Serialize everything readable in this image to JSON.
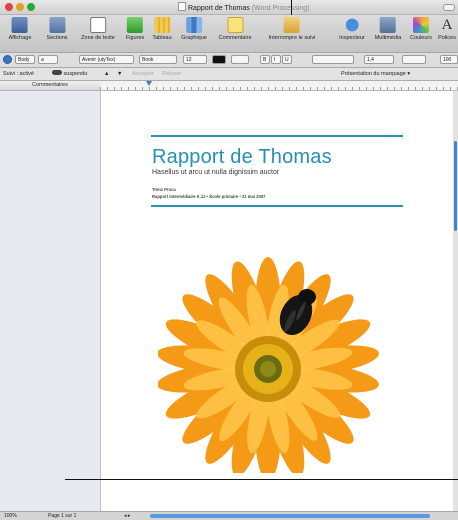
{
  "window": {
    "title": "Rapport de Thomas",
    "subtitle": "(Word Processing)"
  },
  "toolbar": {
    "items": [
      {
        "label": "Affichage",
        "icon": "view-icon"
      },
      {
        "label": "Sections",
        "icon": "sections-icon"
      },
      {
        "label": "Zone de texte",
        "icon": "text-box-icon"
      },
      {
        "label": "Figures",
        "icon": "shapes-icon"
      },
      {
        "label": "Tableau",
        "icon": "table-icon"
      },
      {
        "label": "Graphique",
        "icon": "chart-icon"
      },
      {
        "label": "Commentaire",
        "icon": "comment-icon"
      },
      {
        "label": "Interrompre le suivi",
        "icon": "track-changes-icon"
      },
      {
        "label": "Inspecteur",
        "icon": "inspector-icon"
      },
      {
        "label": "Multimédia",
        "icon": "media-icon"
      },
      {
        "label": "Couleurs",
        "icon": "colors-icon"
      },
      {
        "label": "Polices",
        "icon": "fonts-icon"
      }
    ],
    "font_glyph": "A"
  },
  "format_bar": {
    "style_a": "a",
    "paragraph_style": "Body",
    "font_family": "Avenir (utyTex)",
    "font_weight": "Book",
    "font_size": "12",
    "bold": "B",
    "italic": "I",
    "underline": "U",
    "line_spacing": "1,4",
    "zoom": "100"
  },
  "tracking": {
    "label": "Suivi : activé",
    "state": "suspendu",
    "accept": "Accepter",
    "reject": "Refuser",
    "markup_view": "Présentation du marquage"
  },
  "sidebar": {
    "header": "Commentaires"
  },
  "document": {
    "title": "Rapport de Thomas",
    "subtitle": "Hasellus ut arcu ut nulla dignissim auctor",
    "author": "Trenz Pruca",
    "meta": "Rapport intermédiaire K.12 • École primaire • 21 mai 2007"
  },
  "status": {
    "zoom": "100%",
    "page": "Page 1 sur 1"
  },
  "colors": {
    "accent": "#2590b0",
    "petal": "#f59a16",
    "petal_light": "#ffc74a",
    "center": "#d9a311",
    "bee": "#161616"
  }
}
